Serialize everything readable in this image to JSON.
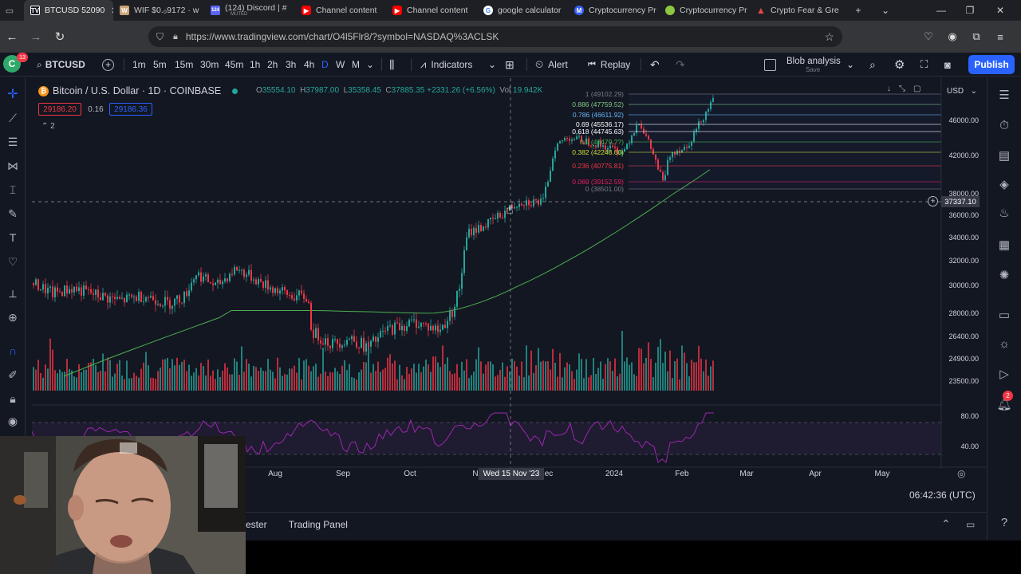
{
  "browser": {
    "tabs": [
      {
        "label": "BTCUSD 52090",
        "favicon": "tradingview-icon",
        "color": "#ffffff",
        "active": true
      },
      {
        "label": "WIF $0.₀9172 · w",
        "favicon": "wif-icon",
        "color": "#c9a57a"
      },
      {
        "label": "(124) Discord | #",
        "sub": "MUTED",
        "favicon": "discord-icon",
        "color": "#5865f2",
        "badge": "124"
      },
      {
        "label": "Channel content",
        "favicon": "youtube-icon",
        "color": "#ff0000"
      },
      {
        "label": "Channel content",
        "favicon": "youtube-icon",
        "color": "#ff0000"
      },
      {
        "label": "google calculator",
        "favicon": "google-icon",
        "color": "#ffffff"
      },
      {
        "label": "Cryptocurrency Pr",
        "favicon": "coinmarketcap-icon",
        "color": "#3861fb"
      },
      {
        "label": "Cryptocurrency Pr",
        "favicon": "coingecko-icon",
        "color": "#8dc63f"
      },
      {
        "label": "Crypto Fear & Gre",
        "favicon": "alternative-icon",
        "color": "#e8483f"
      }
    ],
    "url": "https://www.tradingview.com/chart/O4l5Flr8/?symbol=NASDAQ%3ACLSK"
  },
  "toolbar": {
    "avatar_letter": "C",
    "avatar_badge": "13",
    "symbol": "BTCUSD",
    "intervals": [
      "1m",
      "5m",
      "15m",
      "30m",
      "45m",
      "1h",
      "2h",
      "3h",
      "4h",
      "D",
      "W",
      "M"
    ],
    "active_interval": "D",
    "indicators": "Indicators",
    "alert": "Alert",
    "replay": "Replay",
    "layout_name": "Blob analysis",
    "layout_status": "Save",
    "publish": "Publish"
  },
  "legend": {
    "title": "Bitcoin / U.S. Dollar · 1D · COINBASE",
    "o_label": "O",
    "o": "35554.10",
    "h_label": "H",
    "h": "37987.00",
    "l_label": "L",
    "l": "35358.45",
    "c_label": "C",
    "c": "37885.35",
    "change": "+2331.26 (+6.56%)",
    "vol_label": "Vol",
    "vol": "19.942K",
    "bid": "29186.20",
    "spread": "0.16",
    "ask": "29186.36",
    "collapsed_count": "2"
  },
  "currency": "USD",
  "crosshair": {
    "price": "37337.10",
    "date": "Wed 15 Nov '23"
  },
  "clock": "06:42:36 (UTC)",
  "bottom_tabs": [
    "ester",
    "Trading Panel"
  ],
  "chart_data": {
    "type": "candlestick",
    "symbol": "BTCUSD",
    "exchange": "COINBASE",
    "interval": "1D",
    "x_ticks": [
      "Aug",
      "Sep",
      "Oct",
      "Nov",
      "Dec",
      "2024",
      "Feb",
      "Mar",
      "Apr",
      "May"
    ],
    "price_ticks": [
      "46000.00",
      "42000.00",
      "38000.00",
      "36000.00",
      "34000.00",
      "32000.00",
      "30000.00",
      "28000.00",
      "26400.00",
      "24900.00",
      "23500.00"
    ],
    "rsi_ticks": [
      "80.00",
      "40.00"
    ],
    "fib_levels": [
      {
        "ratio": "1",
        "price": "49102.29",
        "color": "#787b86"
      },
      {
        "ratio": "0.886",
        "price": "47759.52",
        "color": "#81c784"
      },
      {
        "ratio": "0.786",
        "price": "46611.92",
        "color": "#64b5f6"
      },
      {
        "ratio": "0.69",
        "price": "45536.17",
        "color": "#ffffff"
      },
      {
        "ratio": "0.618",
        "price": "44745.63",
        "color": "#ffffff"
      },
      {
        "ratio": "0.5",
        "price": "43479.??",
        "color": "#4caf50"
      },
      {
        "ratio": "0.382",
        "price": "42248.60",
        "color": "#cddc39"
      },
      {
        "ratio": "0.236",
        "price": "40775.81",
        "color": "#f23645"
      },
      {
        "ratio": "0.069",
        "price": "39152.59",
        "color": "#e91e63"
      },
      {
        "ratio": "0",
        "price": "38501.00",
        "color": "#787b86"
      }
    ],
    "up_color": "#26a69a",
    "down_color": "#f23645",
    "ma_color": "#4caf50",
    "rsi_color": "#9c27b0"
  }
}
